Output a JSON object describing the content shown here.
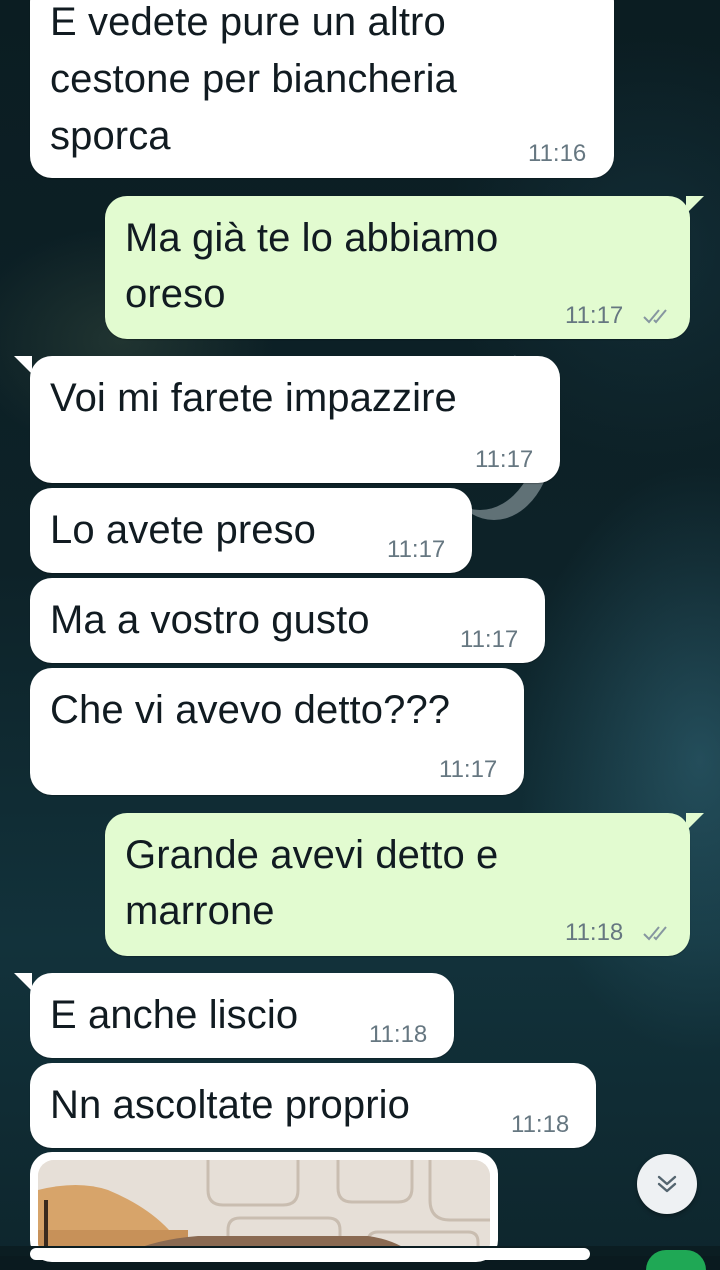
{
  "messages": [
    {
      "direction": "in",
      "text": [
        "E vedete pure un altro",
        "cestone per biancheria",
        "sporca"
      ],
      "time": "11:16"
    },
    {
      "direction": "out",
      "text": [
        "Ma già te lo abbiamo",
        "oreso"
      ],
      "time": "11:17",
      "status": "read-double-check-icon"
    },
    {
      "direction": "in",
      "text": [
        "Voi mi farete impazzire"
      ],
      "time": "11:17"
    },
    {
      "direction": "in",
      "text": [
        "Lo avete preso"
      ],
      "time": "11:17"
    },
    {
      "direction": "in",
      "text": [
        "Ma a vostro gusto"
      ],
      "time": "11:17"
    },
    {
      "direction": "in",
      "text": [
        "Che vi avevo detto???"
      ],
      "time": "11:17"
    },
    {
      "direction": "out",
      "text": [
        "Grande avevi detto e",
        "marrone"
      ],
      "time": "11:18",
      "status": "read-double-check-icon"
    },
    {
      "direction": "in",
      "text": [
        "E anche liscio"
      ],
      "time": "11:18"
    },
    {
      "direction": "in",
      "text": [
        "Nn ascoltate proprio"
      ],
      "time": "11:18"
    },
    {
      "direction": "in",
      "type": "image"
    }
  ],
  "icons": {
    "scroll_down": "chevron-double-down-icon",
    "tick_color": "#8696a0"
  },
  "colors": {
    "incoming_bubble": "#ffffff",
    "outgoing_bubble": "#e2fbd0",
    "time_text": "#667781"
  }
}
